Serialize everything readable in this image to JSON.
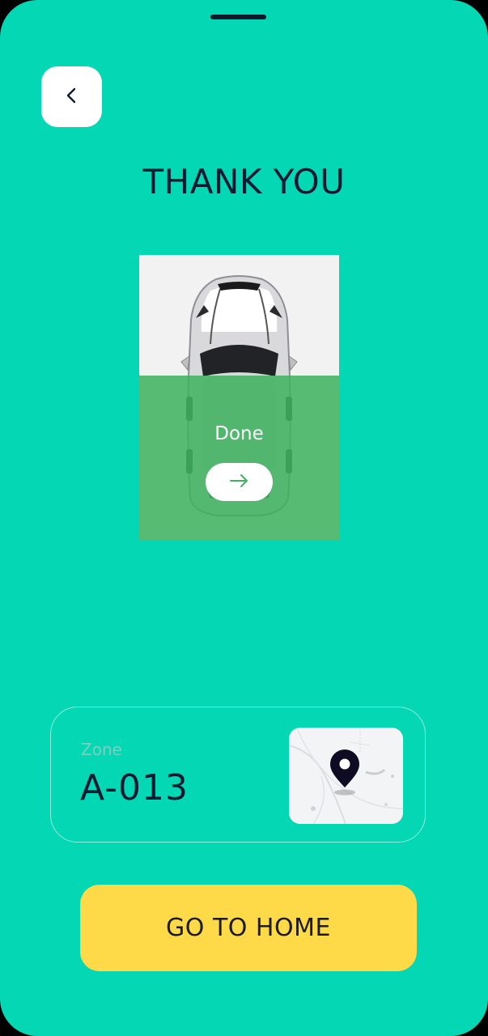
{
  "header": {
    "title": "THANK YOU",
    "back_icon": "chevron-left-icon"
  },
  "car_card": {
    "image": "car-top-view",
    "status_label": "Done",
    "arrow_icon": "arrow-right-icon"
  },
  "zone": {
    "label": "Zone",
    "value": "A-013",
    "map_icon": "map-pin-icon"
  },
  "actions": {
    "home_label": "GO TO HOME"
  },
  "colors": {
    "background": "#04D7B4",
    "accent_yellow": "#FED948",
    "overlay_green": "#3FB25F",
    "text_dark": "#0F1B33"
  }
}
